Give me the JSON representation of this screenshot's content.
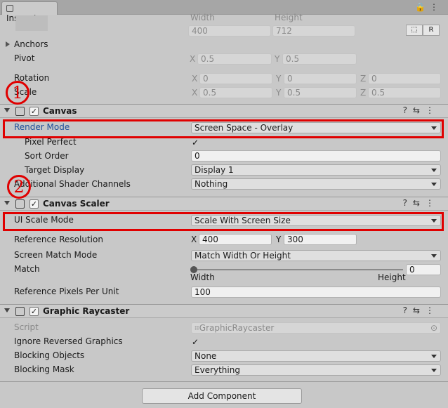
{
  "window": {
    "tab_label": "Inspector",
    "tab_icon": "info-icon"
  },
  "rect_transform": {
    "width_label": "Width",
    "height_label": "Height",
    "width_value": "400",
    "height_value": "712",
    "blueprint_btn": "⬚",
    "raw_btn": "R",
    "anchors_label": "Anchors",
    "pivot": {
      "label": "Pivot",
      "x": "0.5",
      "y": "0.5"
    },
    "rotation": {
      "label": "Rotation",
      "x": "0",
      "y": "0",
      "z": "0"
    },
    "scale": {
      "label": "Scale",
      "x": "0.5",
      "y": "0.5",
      "z": "0.5"
    }
  },
  "axes": {
    "x": "X",
    "y": "Y",
    "z": "Z"
  },
  "canvas": {
    "title": "Canvas",
    "render_mode": {
      "label": "Render Mode",
      "value": "Screen Space - Overlay"
    },
    "pixel_perfect": {
      "label": "Pixel Perfect",
      "checked": true
    },
    "sort_order": {
      "label": "Sort Order",
      "value": "0"
    },
    "target_display": {
      "label": "Target Display",
      "value": "Display 1"
    },
    "shader_channels": {
      "label": "Additional Shader Channels",
      "value": "Nothing"
    }
  },
  "canvas_scaler": {
    "title": "Canvas Scaler",
    "ui_scale_mode": {
      "label": "UI Scale Mode",
      "value": "Scale With Screen Size"
    },
    "reference_resolution": {
      "label": "Reference Resolution",
      "x": "400",
      "y": "300"
    },
    "screen_match_mode": {
      "label": "Screen Match Mode",
      "value": "Match Width Or Height"
    },
    "match": {
      "label": "Match",
      "value": "0",
      "left_label": "Width",
      "right_label": "Height",
      "slider_fraction": 0
    },
    "ref_pixels": {
      "label": "Reference Pixels Per Unit",
      "value": "100"
    }
  },
  "graphic_raycaster": {
    "title": "Graphic Raycaster",
    "script": {
      "label": "Script",
      "value": "GraphicRaycaster"
    },
    "ignore_reversed": {
      "label": "Ignore Reversed Graphics",
      "checked": true
    },
    "blocking_objects": {
      "label": "Blocking Objects",
      "value": "None"
    },
    "blocking_mask": {
      "label": "Blocking Mask",
      "value": "Everything"
    }
  },
  "add_component_label": "Add Component",
  "annotations": {
    "marker_1": "1",
    "marker_2": "2"
  },
  "colors": {
    "highlight": "#e00000",
    "link_blue": "#1e4f9a"
  }
}
